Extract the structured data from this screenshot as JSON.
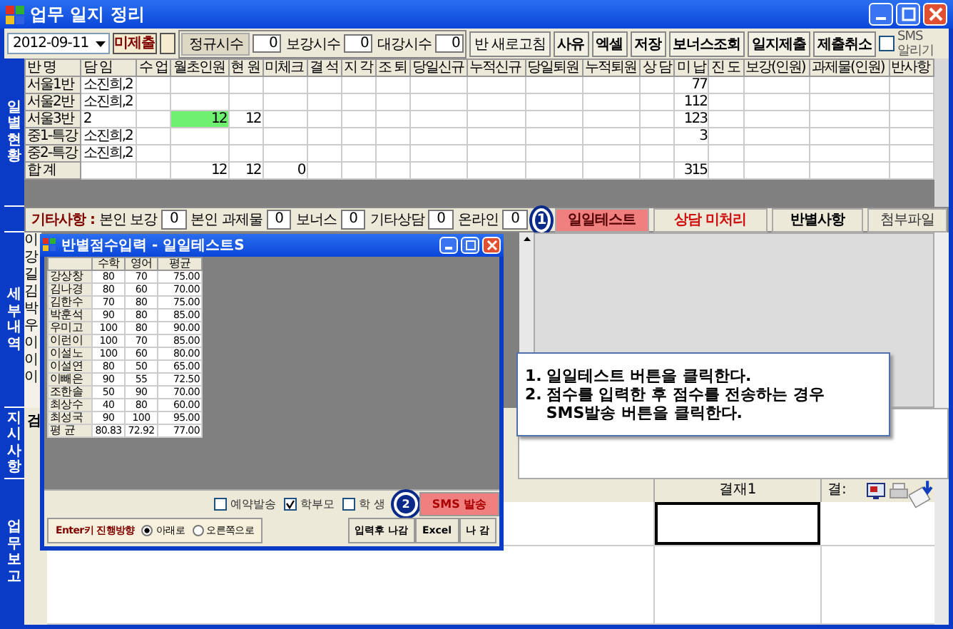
{
  "window": {
    "title": "업무 일지 정리"
  },
  "toolbar": {
    "date": "2012-09-11",
    "status": "미제출",
    "hours": [
      {
        "label": "정규시수",
        "value": "0"
      },
      {
        "label": "보강시수",
        "value": "0"
      },
      {
        "label": "대강시수",
        "value": "0"
      }
    ],
    "buttons": [
      "반 새로고침",
      "사유",
      "엑셀",
      "저장",
      "보너스조회",
      "일지제출",
      "제출취소"
    ],
    "sms_alert": {
      "label": "SMS 알리기",
      "checked": false
    }
  },
  "section_labels": [
    "일별현황",
    "세부내역",
    "지시사항",
    "업무보고"
  ],
  "daily_table": {
    "columns": [
      "반 명",
      "담 임",
      "수 업",
      "월초인원",
      "현 원",
      "미체크",
      "결 석",
      "지 각",
      "조 퇴",
      "당일신규",
      "누적신규",
      "당일퇴원",
      "누적퇴원",
      "상 담",
      "미 납",
      "진 도",
      "보강(인원)",
      "과제물(인원)",
      "반사항"
    ],
    "rows": [
      [
        "서울1반",
        "소진희,2",
        null,
        null,
        null,
        null,
        null,
        null,
        null,
        null,
        null,
        null,
        null,
        null,
        "77",
        null,
        null,
        null,
        null
      ],
      [
        "서울2반",
        "소진희,2",
        null,
        null,
        null,
        null,
        null,
        null,
        null,
        null,
        null,
        null,
        null,
        null,
        "112",
        null,
        null,
        null,
        null
      ],
      [
        "서울3반",
        "2",
        null,
        {
          "text": "12",
          "highlighted": true
        },
        "12",
        null,
        null,
        null,
        null,
        null,
        null,
        null,
        null,
        null,
        "123",
        null,
        null,
        null,
        null
      ],
      [
        "중1-특강",
        "소진희,2",
        null,
        null,
        null,
        null,
        null,
        null,
        null,
        null,
        null,
        null,
        null,
        null,
        "3",
        null,
        null,
        null,
        null
      ],
      [
        "중2-특강",
        "소진희,2",
        null,
        null,
        null,
        null,
        null,
        null,
        null,
        null,
        null,
        null,
        null,
        null,
        null,
        null,
        null,
        null,
        null
      ],
      [
        "합 계",
        null,
        null,
        "12",
        "12",
        "0",
        null,
        null,
        null,
        null,
        null,
        null,
        null,
        null,
        "315",
        null,
        null,
        null,
        null
      ]
    ]
  },
  "other": {
    "label": "기타사항 :",
    "fields": [
      {
        "label": "본인 보강",
        "value": "0"
      },
      {
        "label": "본인 과제물",
        "value": "0"
      },
      {
        "label": "보너스",
        "value": "0"
      },
      {
        "label": "기타상담",
        "value": "0"
      },
      {
        "label": "온라인",
        "value": "0"
      }
    ],
    "badge": "1",
    "buttons": [
      {
        "label": "일일테스트",
        "kind": "highlight"
      },
      {
        "label": "상담 미처리",
        "kind": "alert"
      },
      {
        "label": "반별사항",
        "kind": "bold"
      },
      {
        "label": "첨부파일",
        "kind": "plain"
      }
    ]
  },
  "detail_names_visible": [
    "이",
    "강",
    "길",
    "김",
    "박",
    "우",
    "이",
    "이",
    "이"
  ],
  "instruction_visible": "검",
  "report_table": {
    "columns": [
      "결재1",
      "결:"
    ]
  },
  "dialog": {
    "title": "반별점수입력 - 일일테스트S",
    "columns": [
      "수학",
      "영어",
      "평균"
    ],
    "rows": [
      {
        "name": "강상창",
        "values": [
          "80",
          "70",
          "75.00"
        ]
      },
      {
        "name": "김나경",
        "values": [
          "80",
          "60",
          "70.00"
        ]
      },
      {
        "name": "김한수",
        "values": [
          "70",
          "80",
          "75.00"
        ]
      },
      {
        "name": "박훈석",
        "values": [
          "90",
          "80",
          "85.00"
        ]
      },
      {
        "name": "우미고",
        "values": [
          "100",
          "80",
          "90.00"
        ]
      },
      {
        "name": "이런이",
        "values": [
          "100",
          "70",
          "85.00"
        ]
      },
      {
        "name": "이설노",
        "values": [
          "100",
          "60",
          "80.00"
        ]
      },
      {
        "name": "이설연",
        "values": [
          "80",
          "50",
          "65.00"
        ]
      },
      {
        "name": "이빼은",
        "values": [
          "90",
          "55",
          "72.50"
        ]
      },
      {
        "name": "조한솔",
        "values": [
          "50",
          "90",
          "70.00"
        ]
      },
      {
        "name": "최상수",
        "values": [
          "40",
          "80",
          "60.00"
        ]
      },
      {
        "name": "최성국",
        "values": [
          "90",
          "100",
          "95.00"
        ]
      },
      {
        "name": "평 균",
        "values": [
          "80.83",
          "72.92",
          "77.00"
        ]
      }
    ],
    "options": [
      {
        "label": "예약발송",
        "checked": false
      },
      {
        "label": "학부모",
        "checked": true
      },
      {
        "label": "학 생",
        "checked": false
      }
    ],
    "badge": "2",
    "sms_button": "SMS 발송",
    "direction": {
      "label": "Enter키 진행방향",
      "choices": [
        {
          "label": "아래로",
          "selected": true
        },
        {
          "label": "오른쪽으로",
          "selected": false
        }
      ]
    },
    "buttons": [
      "입력후 나감",
      "Excel",
      "나 감"
    ]
  },
  "callout": {
    "lines": [
      {
        "number": "1.",
        "text": "일일테스트 버튼을 클릭한다."
      },
      {
        "number": "2.",
        "text": "점수를 입력한 후 점수를 전송하는 경우 SMS발송 버튼을 클릭한다."
      }
    ]
  }
}
